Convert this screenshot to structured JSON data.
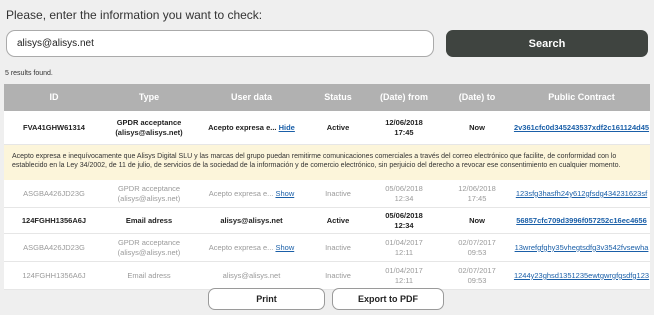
{
  "prompt": "Please, enter the information you want to check:",
  "search": {
    "value": "alisys@alisys.net",
    "button_label": "Search"
  },
  "results_count": "5 results found.",
  "table": {
    "headers": {
      "id": "ID",
      "type": "Type",
      "user": "User data",
      "status": "Status",
      "from": "(Date) from",
      "to": "(Date) to",
      "contract": "Public Contract"
    },
    "rows": [
      {
        "id": "FVA41GHW61314",
        "type": "GPDR acceptance\n(alisys@alisys.net)",
        "user_text": "Acepto expresa e...",
        "user_link": "Hide",
        "status": "Active",
        "from": "12/06/2018\n17:45",
        "to": "Now",
        "contract": "2v361cfc0d345243537xdf2c161124d45"
      },
      {
        "id": "ASGBA426JD23G",
        "type": "GPDR acceptance\n(alisys@alisys.net)",
        "user_text": "Acepto expresa e...",
        "user_link": "Show",
        "status": "Inactive",
        "from": "05/06/2018\n12:34",
        "to": "12/06/2018\n17:45",
        "contract": "123sfg3hasfh24y612gfsdg434231623sf"
      },
      {
        "id": "124FGHH1356A6J",
        "type": "Email adress",
        "user_text": "alisys@alisys.net",
        "status": "Active",
        "from": "05/06/2018\n12:34",
        "to": "Now",
        "contract": "56857cfc709d3996f057252c16ec4656"
      },
      {
        "id": "ASGBA426JD23G",
        "type": "GPDR acceptance\n(alisys@alisys.net)",
        "user_text": "Acepto expresa e...",
        "user_link": "Show",
        "status": "Inactive",
        "from": "01/04/2017\n12:11",
        "to": "02/07/2017\n09:53",
        "contract": "13wrefgfghy35vhegtsdfg3v3542fvsewha"
      },
      {
        "id": "124FGHH1356A6J",
        "type": "Email adress",
        "user_text": "alisys@alisys.net",
        "status": "Inactive",
        "from": "01/04/2017\n12:11",
        "to": "02/07/2017\n09:53",
        "contract": "1244y23ghsd1351235ewtgwrgfgsdfg123"
      }
    ],
    "detail": "Acepto expresa e inequívocamente que Alisys Digital SLU y las marcas del grupo puedan remitirme comunicaciones comerciales a través del correo electrónico que facilite, de conformidad con lo establecido en la Ley 34/2002, de 11 de julio, de servicios de la sociedad de la información y de comercio electrónico, sin perjuicio del derecho a revocar ese consentimiento en cualquier momento."
  },
  "actions": {
    "print": "Print",
    "export": "Export to PDF"
  }
}
